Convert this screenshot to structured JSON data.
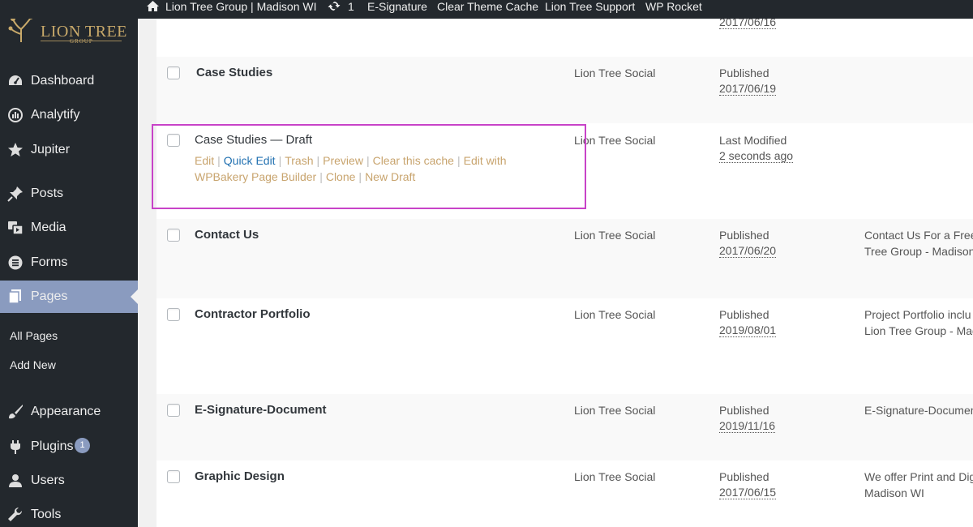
{
  "adminbar": {
    "site_name": "Lion Tree Group | Madison WI",
    "updates_count": "1",
    "items": [
      "E-Signature",
      "Clear Theme Cache",
      "Lion Tree Support",
      "WP Rocket"
    ]
  },
  "logo": {
    "text": "LION TREE",
    "sub": "GROUP"
  },
  "sidebar": {
    "menu": [
      {
        "label": "Dashboard",
        "icon": "dashboard-icon"
      },
      {
        "label": "Analytify",
        "icon": "analytics-icon"
      },
      {
        "label": "Jupiter",
        "icon": "star-icon"
      },
      {
        "label": "Posts",
        "icon": "pin-icon"
      },
      {
        "label": "Media",
        "icon": "media-icon"
      },
      {
        "label": "Forms",
        "icon": "forms-icon"
      },
      {
        "label": "Pages",
        "icon": "pages-icon"
      },
      {
        "label": "Appearance",
        "icon": "brush-icon"
      },
      {
        "label": "Plugins",
        "icon": "plugin-icon",
        "badge": "1"
      },
      {
        "label": "Users",
        "icon": "user-icon"
      },
      {
        "label": "Tools",
        "icon": "wrench-icon"
      }
    ],
    "submenu": [
      "All Pages",
      "Add New"
    ]
  },
  "top_partial_date": "2017/06/16",
  "rows": [
    {
      "title": "Case Studies",
      "author": "Lion Tree Social",
      "status": "Published",
      "date": "2017/06/19",
      "desc": []
    },
    {
      "title": "Case Studies — Draft",
      "author": "Lion Tree Social",
      "status": "Last Modified",
      "date": "2 seconds ago",
      "desc": [],
      "actions": [
        "Edit",
        "Quick Edit",
        "Trash",
        "Preview",
        "Clear this cache",
        "Edit with WPBakery Page Builder",
        "Clone",
        "New Draft"
      ]
    },
    {
      "title": "Contact Us",
      "author": "Lion Tree Social",
      "status": "Published",
      "date": "2017/06/20",
      "desc": [
        "Contact Us For a Free",
        "Tree Group - Madison"
      ]
    },
    {
      "title": "Contractor Portfolio",
      "author": "Lion Tree Social",
      "status": "Published",
      "date": "2019/08/01",
      "desc": [
        "Project Portfolio inclu",
        "Lion Tree Group - Mad"
      ]
    },
    {
      "title": "E-Signature-Document",
      "author": "Lion Tree Social",
      "status": "Published",
      "date": "2019/11/16",
      "desc": [
        "E-Signature-Documen"
      ]
    },
    {
      "title": "Graphic Design",
      "author": "Lion Tree Social",
      "status": "Published",
      "date": "2017/06/15",
      "desc": [
        "We offer Print and Dig",
        "Madison WI"
      ]
    }
  ],
  "colors": {
    "sidebar_bg": "#23282d",
    "active_menu": "#8a9bbf",
    "action_link": "#c8a46e",
    "quick_edit_link": "#2271b1",
    "highlight_box": "#c843c8"
  }
}
